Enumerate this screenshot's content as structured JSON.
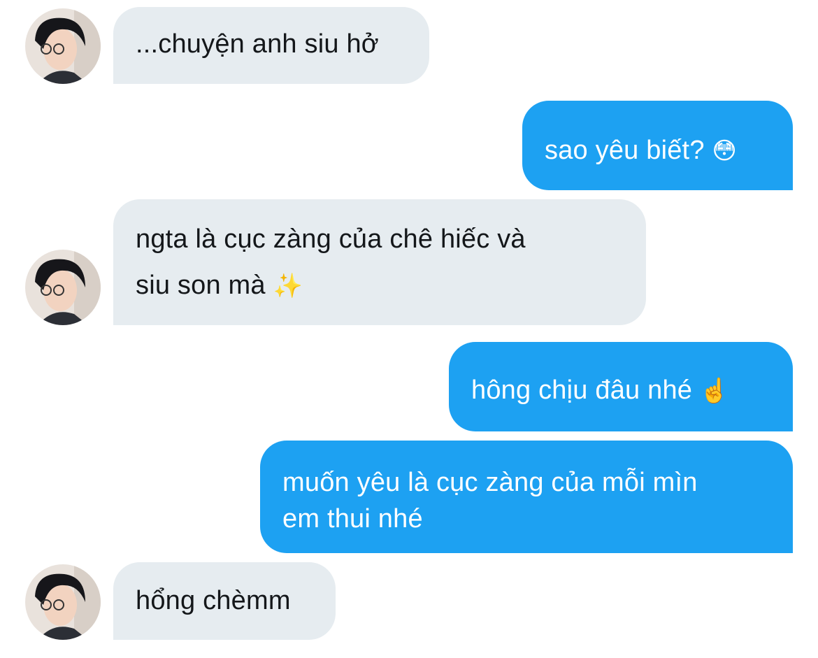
{
  "messages": [
    {
      "sender": "them",
      "text": "...chuyện anh siu hở"
    },
    {
      "sender": "me",
      "text": "sao yêu biết?",
      "emoji": "😳"
    },
    {
      "sender": "them",
      "lines": [
        "ngta là cục zàng của chê hiếc và",
        "siu son mà"
      ],
      "emoji": "✨"
    },
    {
      "sender": "me",
      "text": "hông chịu đâu nhé",
      "emoji": "☝️"
    },
    {
      "sender": "me",
      "lines": [
        "muốn yêu là cục zàng của mỗi mìn",
        "em thui nhé"
      ]
    },
    {
      "sender": "them",
      "text": "hổng chèmm"
    }
  ],
  "colors": {
    "incoming_bubble": "#e6ecf0",
    "outgoing_bubble": "#1da1f2",
    "incoming_text": "#14171a",
    "outgoing_text": "#ffffff"
  }
}
